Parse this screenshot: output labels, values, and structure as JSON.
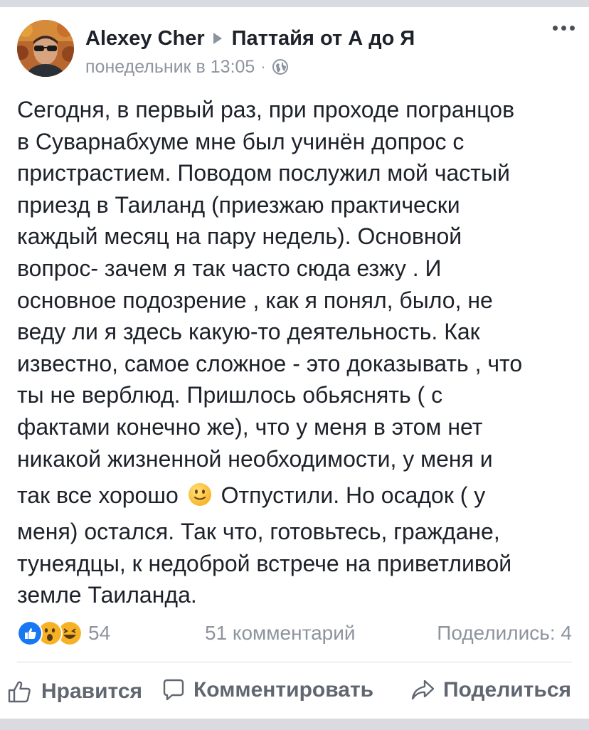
{
  "post": {
    "author": "Alexey Cher",
    "group": "Паттайя от А до Я",
    "timestamp": "понедельник в 13:05",
    "privacy_icon": "globe-icon",
    "menu_icon": "more-options-icon",
    "text_lines": [
      "Сегодня, в первый раз, при проходе погранцов",
      "в Суварнабхуме мне был учинён допрос с",
      "пристрастием. Поводом послужил мой частый",
      "приезд в Таиланд (приезжаю практически",
      "каждый месяц на пару недель). Основной",
      "вопрос- зачем я так часто сюда езжу . И",
      "основное подозрение , как я понял, было, не",
      "веду ли я здесь какую-то деятельность. Как",
      "известно, самое сложное - это доказывать , что",
      "ты не верблюд. Пришлось обьяснять ( с",
      "фактами конечно же), что у меня в этом нет",
      "никакой жизненной необходимости, у меня и"
    ],
    "text_line_emoji_before": "так все хорошо",
    "text_line_emoji_after": "Отпустили. Но осадок ( у",
    "text_lines_end": [
      "меня) остался. Так что, готовьтесь, граждане,",
      "тунеядцы, к недоброй встрече на приветливой",
      "земле Таиланда."
    ],
    "emoji": "slightly-smiling-face"
  },
  "stats": {
    "reaction_icons": [
      "like-reaction-icon",
      "wow-reaction-icon",
      "haha-reaction-icon"
    ],
    "reactions_count": "54",
    "comments": "51 комментарий",
    "shares": "Поделились: 4"
  },
  "actions": {
    "like": "Нравится",
    "comment": "Комментировать",
    "share": "Поделиться"
  },
  "colors": {
    "text": "#1d2129",
    "meta": "#8d949e",
    "action": "#606770",
    "like_blue": "#1877f2",
    "emoji_yellow": "#f7b125"
  }
}
